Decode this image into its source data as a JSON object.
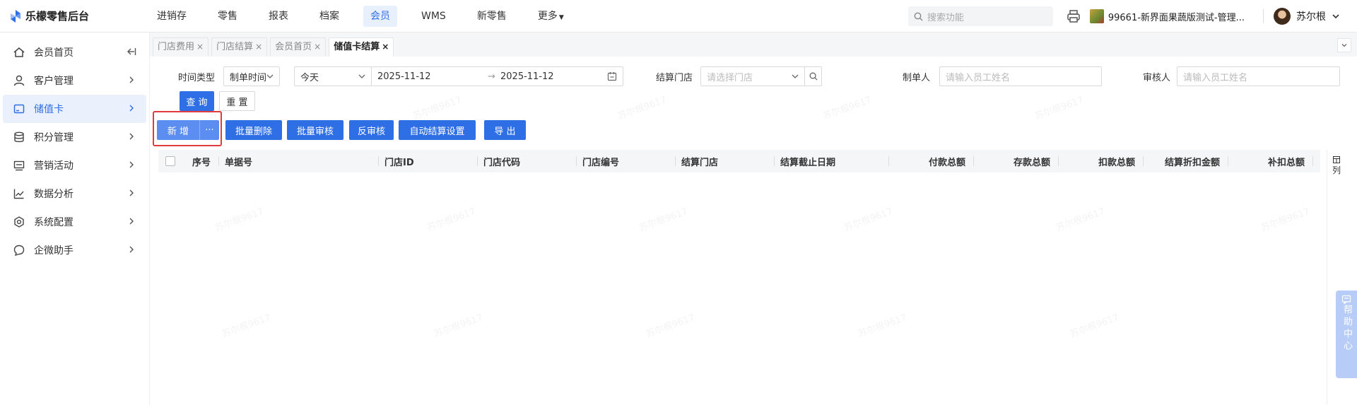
{
  "app": {
    "title": "乐檬零售后台"
  },
  "nav": [
    {
      "label": "进销存",
      "active": false
    },
    {
      "label": "零售",
      "active": false
    },
    {
      "label": "报表",
      "active": false
    },
    {
      "label": "档案",
      "active": false
    },
    {
      "label": "会员",
      "active": true
    },
    {
      "label": "WMS",
      "active": false
    },
    {
      "label": "新零售",
      "active": false
    },
    {
      "label": "更多",
      "active": false
    }
  ],
  "top": {
    "search_placeholder": "搜索功能",
    "store": "99661-新界面果蔬版测试-管理...",
    "user": "苏尔根"
  },
  "sidebar": [
    {
      "label": "会员首页",
      "icon": "home-icon",
      "active": false
    },
    {
      "label": "客户管理",
      "icon": "user-icon",
      "active": false
    },
    {
      "label": "储值卡",
      "icon": "card-icon",
      "active": true
    },
    {
      "label": "积分管理",
      "icon": "coins-icon",
      "active": false
    },
    {
      "label": "营销活动",
      "icon": "campaign-icon",
      "active": false
    },
    {
      "label": "数据分析",
      "icon": "chart-icon",
      "active": false
    },
    {
      "label": "系统配置",
      "icon": "settings-icon",
      "active": false
    },
    {
      "label": "企微助手",
      "icon": "chat-icon",
      "active": false
    }
  ],
  "tabs": [
    {
      "label": "门店费用",
      "active": false
    },
    {
      "label": "门店结算",
      "active": false
    },
    {
      "label": "会员首页",
      "active": false
    },
    {
      "label": "储值卡结算",
      "active": true
    }
  ],
  "filters": {
    "time_type_label": "时间类型",
    "time_type_value": "制单时间",
    "period_value": "今天",
    "date_start": "2025-11-12",
    "date_sep": "→",
    "date_end": "2025-11-12",
    "store_label": "结算门店",
    "store_placeholder": "请选择门店",
    "maker_label": "制单人",
    "maker_placeholder": "请输入员工姓名",
    "auditor_label": "审核人",
    "auditor_placeholder": "请输入员工姓名",
    "query": "查 询",
    "reset": "重 置"
  },
  "toolbar": {
    "add": "新 增",
    "more": "···",
    "batch_delete": "批量删除",
    "batch_audit": "批量审核",
    "unaudit": "反审核",
    "auto_settle": "自动结算设置",
    "export": "导 出"
  },
  "table": {
    "columns": [
      "序号",
      "单据号",
      "门店ID",
      "门店代码",
      "门店编号",
      "结算门店",
      "结算截止日期",
      "付款总额",
      "存款总额",
      "扣款总额",
      "结算折扣金额",
      "补扣总额"
    ],
    "column_toggle": "列"
  },
  "help": {
    "label": "帮助中心"
  },
  "watermark": "苏尔根9617",
  "colors": {
    "primary": "#2f6fe6",
    "highlight_box": "#e23b3b"
  }
}
